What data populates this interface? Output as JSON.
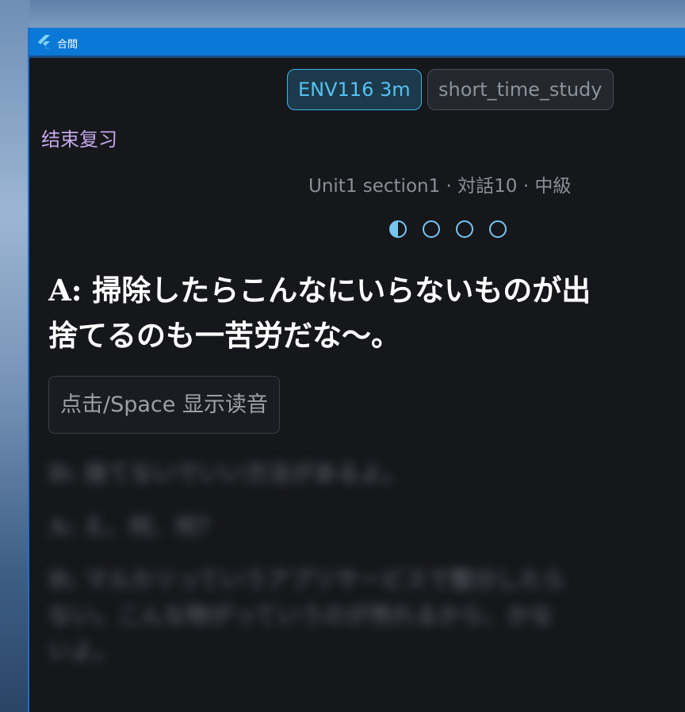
{
  "window": {
    "title": "合間",
    "accent": "#0a78d7"
  },
  "chips": {
    "active_label": "ENV116 3m",
    "inactive_label": "short_time_study"
  },
  "controls": {
    "end_review_label": "结束复习",
    "reveal_reading_label": "点击/Space 显示读音"
  },
  "lesson": {
    "meta": "Unit1 section1 · 対話10 · 中級",
    "progress": {
      "current": 1,
      "total": 4,
      "current_fill": 0.5
    }
  },
  "dialogue": {
    "line_a_1": "A: 掃除したらこんなにいらないものが出",
    "line_a_2": "捨てるのも一苦労だな〜。",
    "hidden": [
      "B: 捨てないでいい方法があるよ。",
      "A: え、何、何？",
      "B: マルカリっていうアプリサービスで整分したら",
      "ない。こんな物がっていうのが売れるから、かな",
      "いよ。"
    ]
  },
  "icons": {
    "app": "flutter-logo-icon"
  }
}
